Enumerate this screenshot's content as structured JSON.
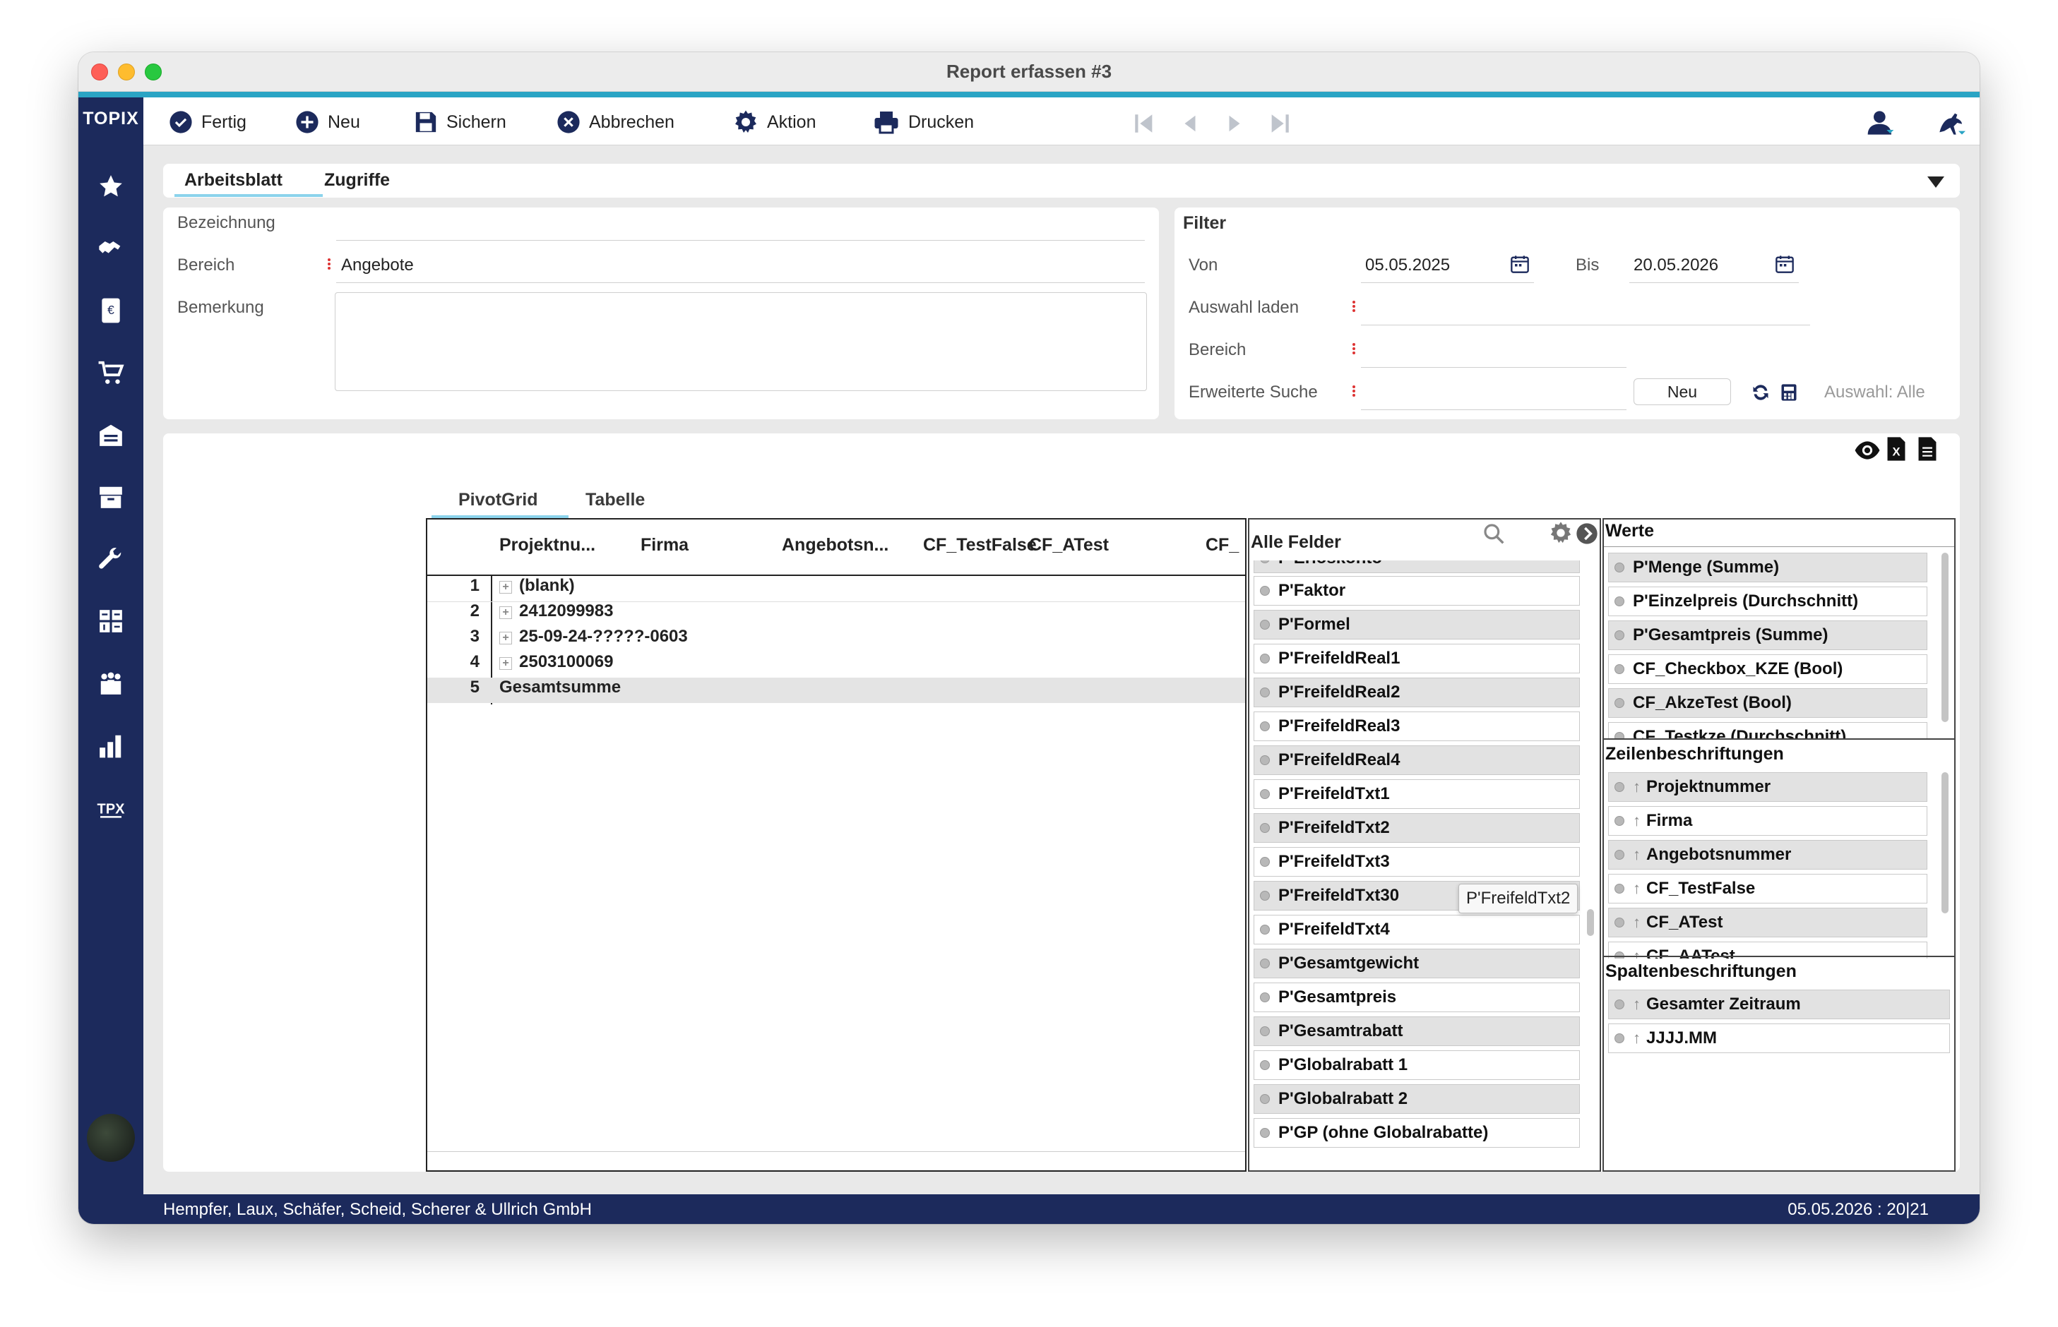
{
  "window": {
    "title": "Report erfassen #3"
  },
  "app": {
    "logo": "TOPIX"
  },
  "sidebar": {
    "items": [
      "star-icon",
      "handshake-icon",
      "invoice-icon",
      "cart-icon",
      "warehouse-icon",
      "archive-icon",
      "wrench-icon",
      "apps-icon",
      "people-icon",
      "bar-chart-icon",
      "tpx-icon"
    ]
  },
  "toolbar": {
    "fertig": "Fertig",
    "neu": "Neu",
    "sichern": "Sichern",
    "abbrechen": "Abbrechen",
    "aktion": "Aktion",
    "drucken": "Drucken"
  },
  "tabs": {
    "arbeitsblatt": "Arbeitsblatt",
    "zugriffe": "Zugriffe"
  },
  "form": {
    "bezeichnung_label": "Bezeichnung",
    "bezeichnung_value": "",
    "bereich_label": "Bereich",
    "bereich_value": "Angebote",
    "bemerkung_label": "Bemerkung",
    "bemerkung_value": ""
  },
  "filter": {
    "title": "Filter",
    "von_label": "Von",
    "von_value": "05.05.2025",
    "bis_label": "Bis",
    "bis_value": "20.05.2026",
    "auswahl_label": "Auswahl laden",
    "bereich_label": "Bereich",
    "suche_label": "Erweiterte Suche",
    "neu_button": "Neu",
    "auswahl_status": "Auswahl: Alle"
  },
  "grid_tabs": {
    "pivot": "PivotGrid",
    "tabelle": "Tabelle"
  },
  "pivot": {
    "columns": [
      "Projektnu...",
      "Firma",
      "Angebotsn...",
      "CF_TestFalse",
      "CF_ATest",
      "CF_"
    ],
    "rows": [
      {
        "num": "1",
        "label": "(blank)",
        "expand": "+"
      },
      {
        "num": "2",
        "label": "2412099983",
        "expand": "+"
      },
      {
        "num": "3",
        "label": "25-09-24-?????-0603",
        "expand": "+"
      },
      {
        "num": "4",
        "label": "2503100069",
        "expand": "+"
      },
      {
        "num": "5",
        "label": "Gesamtsumme",
        "expand": ""
      }
    ]
  },
  "fields": {
    "title": "Alle Felder",
    "items": [
      "P'Erloskonto",
      "P'Faktor",
      "P'Formel",
      "P'FreifeldReal1",
      "P'FreifeldReal2",
      "P'FreifeldReal3",
      "P'FreifeldReal4",
      "P'FreifeldTxt1",
      "P'FreifeldTxt2",
      "P'FreifeldTxt3",
      "P'FreifeldTxt30",
      "P'FreifeldTxt4",
      "P'Gesamtgewicht",
      "P'Gesamtpreis",
      "P'Gesamtrabatt",
      "P'Globalrabatt 1",
      "P'Globalrabatt 2",
      "P'GP (ohne Globalrabatte)"
    ],
    "tooltip": "P'FreifeldTxt2"
  },
  "werte": {
    "title": "Werte",
    "items": [
      "P'Menge (Summe)",
      "P'Einzelpreis (Durchschnitt)",
      "P'Gesamtpreis (Summe)",
      "CF_Checkbox_KZE (Bool)",
      "CF_AkzeTest (Bool)",
      "CF_Testkze (Durchschnitt)"
    ]
  },
  "zeilen": {
    "title": "Zeilenbeschriftungen",
    "items": [
      "Projektnummer",
      "Firma",
      "Angebotsnummer",
      "CF_TestFalse",
      "CF_ATest",
      "CF_AATest"
    ]
  },
  "spalten": {
    "title": "Spaltenbeschriftungen",
    "items": [
      "Gesamter Zeitraum",
      "JJJJ.MM"
    ]
  },
  "status": {
    "company": "Hempfer, Laux, Schäfer, Scheid, Scherer & Ullrich GmbH",
    "datetime": "05.05.2026 : 20|21"
  }
}
